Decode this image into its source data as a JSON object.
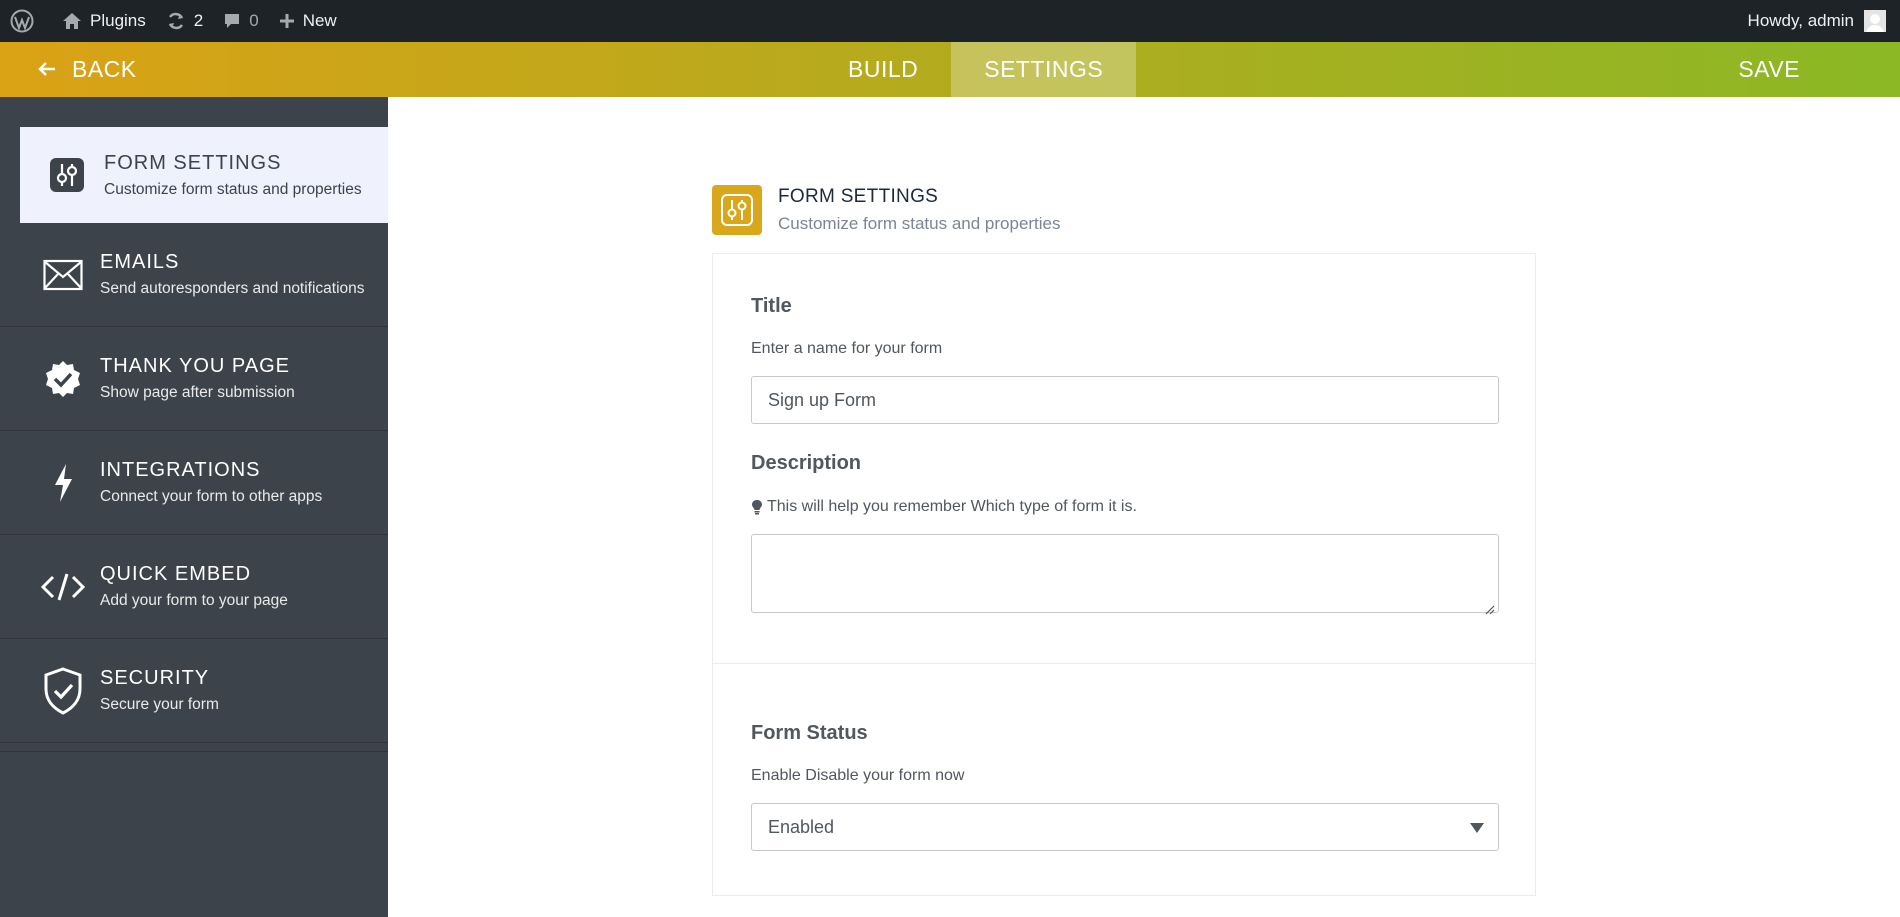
{
  "adminbar": {
    "site_label": "Plugins",
    "updates_count": "2",
    "comments_count": "0",
    "new_label": "New",
    "howdy": "Howdy, admin"
  },
  "topbar": {
    "back_label": "BACK",
    "tabs": [
      {
        "label": "BUILD",
        "active": false
      },
      {
        "label": "SETTINGS",
        "active": true
      }
    ],
    "save_label": "SAVE"
  },
  "sidebar": {
    "items": [
      {
        "title": "FORM SETTINGS",
        "subtitle": "Customize form status and properties",
        "icon": "sliders-icon",
        "active": true
      },
      {
        "title": "EMAILS",
        "subtitle": "Send autoresponders and notifications",
        "icon": "envelope-icon",
        "active": false
      },
      {
        "title": "THANK YOU PAGE",
        "subtitle": "Show page after submission",
        "icon": "badge-check-icon",
        "active": false
      },
      {
        "title": "INTEGRATIONS",
        "subtitle": "Connect your form to other apps",
        "icon": "bolt-icon",
        "active": false
      },
      {
        "title": "QUICK EMBED",
        "subtitle": "Add your form to your page",
        "icon": "code-icon",
        "active": false
      },
      {
        "title": "SECURITY",
        "subtitle": "Secure your form",
        "icon": "shield-check-icon",
        "active": false
      }
    ]
  },
  "main": {
    "header": {
      "title": "FORM SETTINGS",
      "subtitle": "Customize form status and properties"
    },
    "title_field": {
      "label": "Title",
      "help": "Enter a name for your form",
      "value": "Sign up Form"
    },
    "description_field": {
      "label": "Description",
      "help": "This will help you remember Which type of form it is.",
      "value": ""
    },
    "status_field": {
      "label": "Form Status",
      "help": "Enable Disable your form now",
      "selected": "Enabled"
    }
  },
  "colors": {
    "admin_bar": "#1d2327",
    "gradient_start": "#dba215",
    "gradient_end": "#8bb825",
    "sidebar_bg": "#3c434a",
    "accent_icon": "#d8a71b"
  }
}
